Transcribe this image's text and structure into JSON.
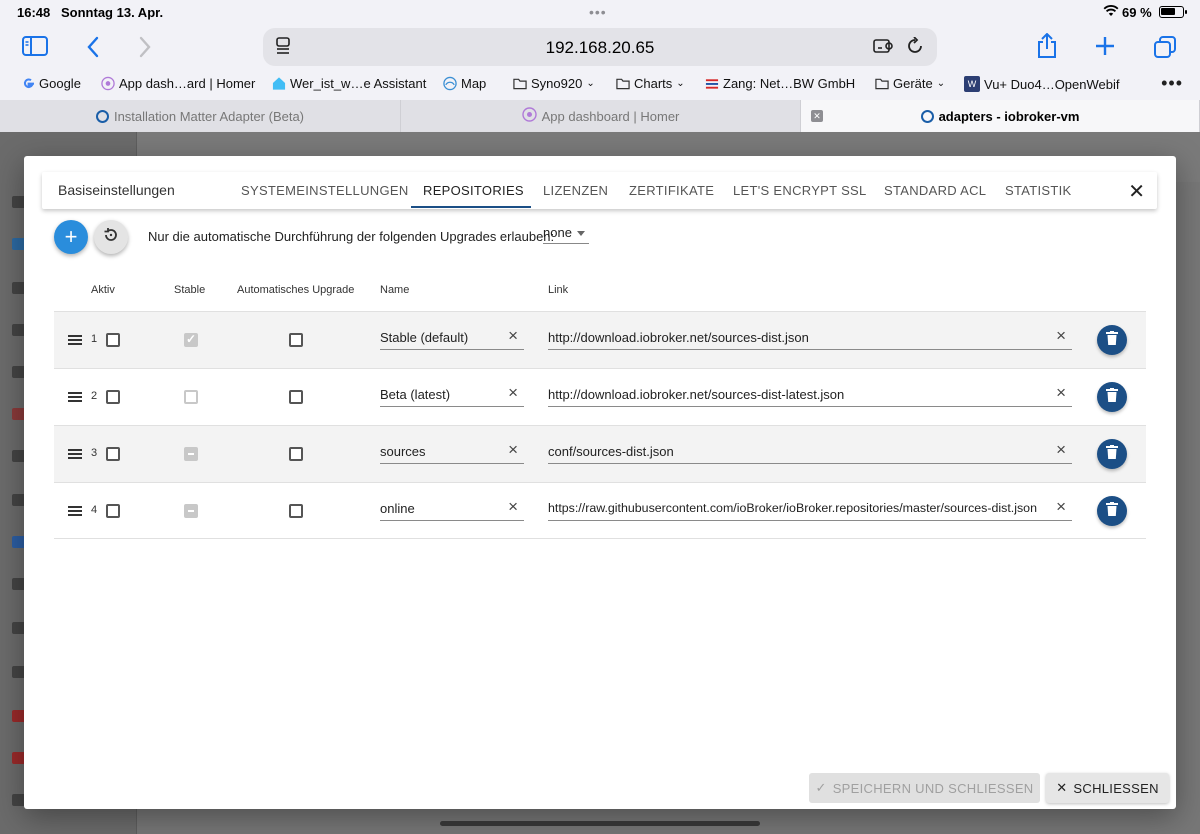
{
  "status": {
    "time": "16:48",
    "date": "Sonntag 13. Apr.",
    "battery": "69 %"
  },
  "toolbar": {
    "url": "192.168.20.65"
  },
  "bookmarks": [
    {
      "label": "Google",
      "icon": "google-icon"
    },
    {
      "label": "App dash…ard | Homer",
      "icon": "homer-icon"
    },
    {
      "label": "Wer_ist_w…e Assistant",
      "icon": "home-assistant-icon"
    },
    {
      "label": "Map",
      "icon": "map-icon"
    },
    {
      "label": "Syno920",
      "icon": "folder-icon"
    },
    {
      "label": "Charts",
      "icon": "folder-icon"
    },
    {
      "label": "Zang: Net…BW GmbH",
      "icon": "netbw-icon"
    },
    {
      "label": "Geräte",
      "icon": "folder-icon"
    },
    {
      "label": "Vu+ Duo4…OpenWebif",
      "icon": "openwebif-icon"
    }
  ],
  "tabs": [
    {
      "label": "Installation Matter Adapter (Beta)"
    },
    {
      "label": "App dashboard | Homer"
    },
    {
      "label": "adapters - iobroker-vm"
    }
  ],
  "dialog": {
    "title": "Basiseinstellungen",
    "tabs": [
      "SYSTEMEINSTELLUNGEN",
      "REPOSITORIES",
      "LIZENZEN",
      "ZERTIFIKATE",
      "LET'S ENCRYPT SSL",
      "STANDARD ACL",
      "STATISTIK"
    ],
    "active_tab": "REPOSITORIES",
    "upgrade_label": "Nur die automatische Durchführung der folgenden Upgrades erlauben:",
    "upgrade_value": "none",
    "columns": {
      "aktiv": "Aktiv",
      "stable": "Stable",
      "auto": "Automatisches Upgrade",
      "name": "Name",
      "link": "Link"
    },
    "rows": [
      {
        "num": "1",
        "name": "Stable (default)",
        "link": "http://download.iobroker.net/sources-dist.json"
      },
      {
        "num": "2",
        "name": "Beta (latest)",
        "link": "http://download.iobroker.net/sources-dist-latest.json"
      },
      {
        "num": "3",
        "name": "sources",
        "link": "conf/sources-dist.json"
      },
      {
        "num": "4",
        "name": "online",
        "link": "https://raw.githubusercontent.com/ioBroker/ioBroker.repositories/master/sources-dist.json"
      }
    ],
    "save_label": "SPEICHERN UND SCHLIESSEN",
    "close_label": "SCHLIESSEN"
  },
  "colors": {
    "primary": "#1c4f86",
    "fab": "#2a8ddc",
    "safari_blue": "#1a73e8"
  }
}
